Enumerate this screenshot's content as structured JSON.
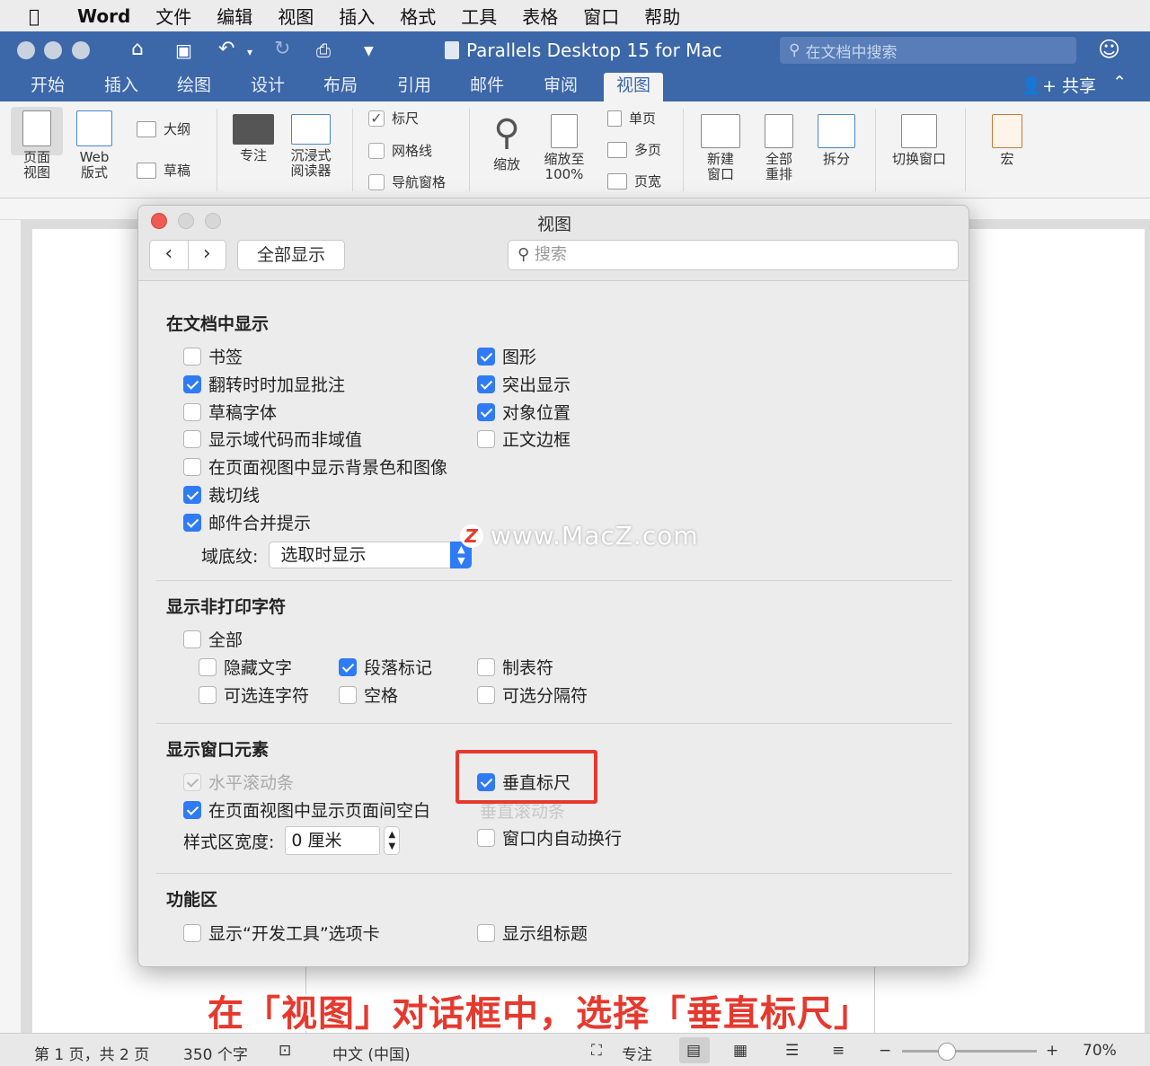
{
  "menubar": {
    "apple": "",
    "app": "Word",
    "items": [
      "文件",
      "编辑",
      "视图",
      "插入",
      "格式",
      "工具",
      "表格",
      "窗口",
      "帮助"
    ]
  },
  "titlebar": {
    "title": "Parallels Desktop 15 for Mac",
    "search_placeholder": "在文档中搜索"
  },
  "tabs": [
    "开始",
    "插入",
    "绘图",
    "设计",
    "布局",
    "引用",
    "邮件",
    "审阅",
    "视图"
  ],
  "active_tab": "视图",
  "share_label": "共享",
  "ribbon": {
    "page_view": "页面\n视图",
    "web_view": "Web\n版式",
    "outline": "大纲",
    "draft": "草稿",
    "focus": "专注",
    "immersive": "沉浸式\n阅读器",
    "ruler": "标尺",
    "gridlines": "网格线",
    "nav_pane": "导航窗格",
    "zoom": "缩放",
    "zoom100": "缩放至\n100%",
    "one_page": "单页",
    "multi_page": "多页",
    "page_width": "页宽",
    "new_window": "新建\n窗口",
    "arrange_all": "全部\n重排",
    "split": "拆分",
    "switch_window": "切换窗口",
    "macros": "宏"
  },
  "dialog": {
    "title": "视图",
    "show_all": "全部显示",
    "search_placeholder": "搜索",
    "section_document": "在文档中显示",
    "doc_left": [
      {
        "label": "书签",
        "checked": false
      },
      {
        "label": "翻转时时加显批注",
        "checked": true
      },
      {
        "label": "草稿字体",
        "checked": false
      },
      {
        "label": "显示域代码而非域值",
        "checked": false
      },
      {
        "label": "在页面视图中显示背景色和图像",
        "checked": false
      },
      {
        "label": "裁切线",
        "checked": true
      },
      {
        "label": "邮件合并提示",
        "checked": true
      }
    ],
    "doc_right": [
      {
        "label": "图形",
        "checked": true
      },
      {
        "label": "突出显示",
        "checked": true
      },
      {
        "label": "对象位置",
        "checked": true
      },
      {
        "label": "正文边框",
        "checked": false
      }
    ],
    "field_shading_label": "域底纹:",
    "field_shading_value": "选取时显示",
    "section_nonprinting": "显示非打印字符",
    "np_all": "全部",
    "np_items": [
      {
        "label": "隐藏文字",
        "checked": false
      },
      {
        "label": "段落标记",
        "checked": true
      },
      {
        "label": "制表符",
        "checked": false
      },
      {
        "label": "可选连字符",
        "checked": false
      },
      {
        "label": "空格",
        "checked": false
      },
      {
        "label": "可选分隔符",
        "checked": false
      }
    ],
    "section_window": "显示窗口元素",
    "win_hscroll": "水平滚动条",
    "win_whitespace": "在页面视图中显示页面间空白",
    "win_vruler": "垂直标尺",
    "win_vscroll": "垂直滚动条",
    "win_wrap": "窗口内自动换行",
    "style_width_label": "样式区宽度:",
    "style_width_value": "0 厘米",
    "section_ribbon": "功能区",
    "rib_dev": "显示“开发工具”选项卡",
    "rib_group": "显示组标题"
  },
  "watermark": "www.MacZ.com",
  "watermark_logo": "Z",
  "caption": "在「视图」对话框中，选择「垂直标尺」",
  "status": {
    "page": "第 1 页，共 2 页",
    "words": "350 个字",
    "lang": "中文 (中国)",
    "focus": "专注",
    "zoom": "70%"
  },
  "colors": {
    "title_blue": "#3c67a8",
    "check_blue": "#2f7bf5",
    "highlight_red": "#e6392e"
  }
}
